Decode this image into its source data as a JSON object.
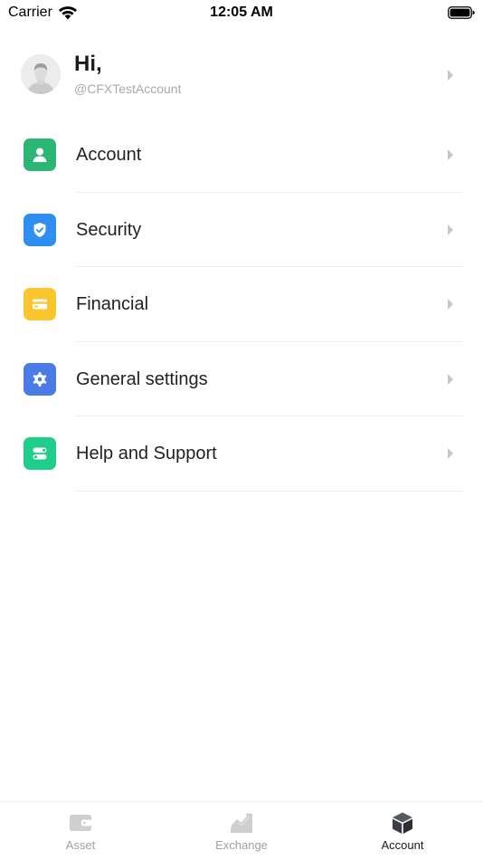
{
  "status_bar": {
    "carrier": "Carrier",
    "time": "12:05 AM"
  },
  "profile": {
    "greeting": "Hi,",
    "handle": "@CFXTestAccount"
  },
  "menu": {
    "items": [
      {
        "label": "Account",
        "icon": "person-icon",
        "color": "#2bb673"
      },
      {
        "label": "Security",
        "icon": "shield-icon",
        "color": "#2e8ff0"
      },
      {
        "label": "Financial",
        "icon": "card-icon",
        "color": "#fbc52e"
      },
      {
        "label": "General settings",
        "icon": "gear-icon",
        "color": "#4a7be6"
      },
      {
        "label": "Help and Support",
        "icon": "toggle-icon",
        "color": "#1fce8a"
      }
    ]
  },
  "tab_bar": {
    "tabs": [
      {
        "label": "Asset",
        "icon": "wallet-icon",
        "active": false
      },
      {
        "label": "Exchange",
        "icon": "chart-icon",
        "active": false
      },
      {
        "label": "Account",
        "icon": "cube-icon",
        "active": true
      }
    ]
  }
}
